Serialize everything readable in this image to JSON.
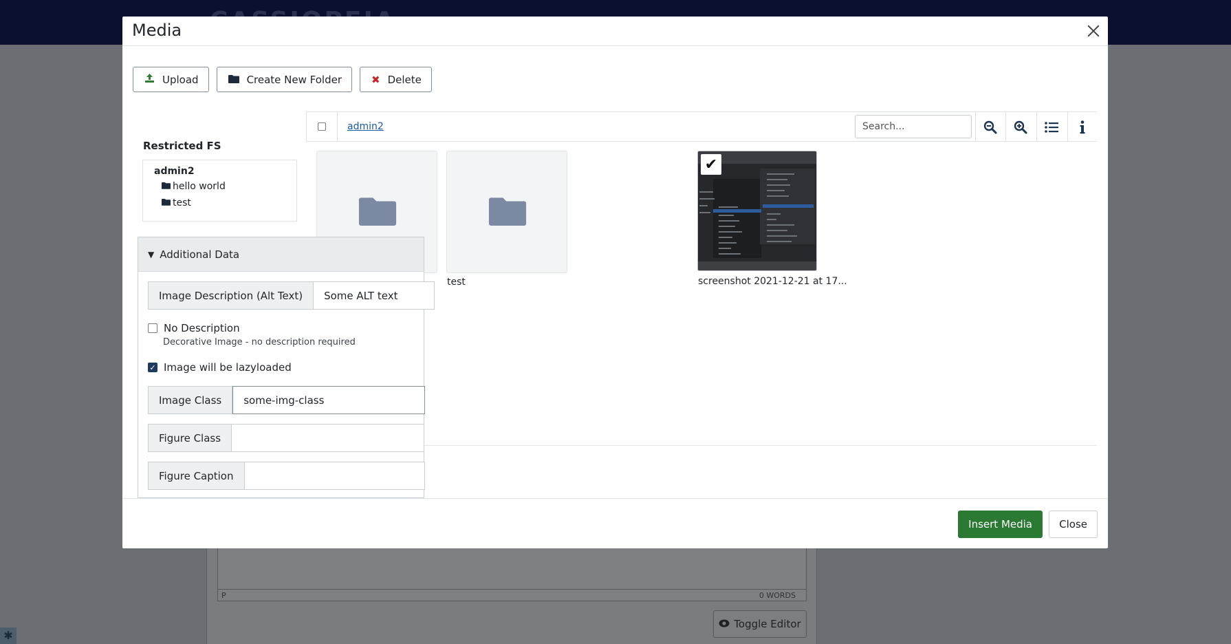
{
  "background": {
    "site_title": "CASSIOPEIA",
    "editor_status_left": "P",
    "editor_status_right": "0 WORDS",
    "toggle_editor_label": "Toggle Editor"
  },
  "modal": {
    "title": "Media",
    "toolbar": {
      "upload_label": "Upload",
      "create_folder_label": "Create New Folder",
      "delete_label": "Delete"
    },
    "tree": {
      "title": "Restricted FS",
      "root": "admin2",
      "items": [
        "hello world",
        "test"
      ]
    },
    "browser": {
      "breadcrumb": "admin2",
      "search_placeholder": "Search...",
      "icons": [
        "zoom-out-icon",
        "zoom-in-icon",
        "list-view-icon",
        "info-icon"
      ],
      "items": [
        {
          "name": "",
          "type": "folder"
        },
        {
          "name": "test",
          "type": "folder"
        },
        {
          "name": "screenshot 2021-12-21 at 17...",
          "type": "image",
          "selected": true
        }
      ]
    },
    "additional_data": {
      "header": "Additional Data",
      "alt_label": "Image Description (Alt Text)",
      "alt_value": "Some ALT text",
      "no_desc_label": "No Description",
      "no_desc_checked": false,
      "no_desc_note": "Decorative Image - no description required",
      "lazy_label": "Image will be lazyloaded",
      "lazy_checked": true,
      "image_class_label": "Image Class",
      "image_class_value": "some-img-class",
      "figure_class_label": "Figure Class",
      "figure_class_value": "",
      "figure_caption_label": "Figure Caption",
      "figure_caption_value": ""
    },
    "footer": {
      "insert_label": "Insert Media",
      "close_label": "Close"
    },
    "colors": {
      "insert_button": "#2b7a34",
      "delete_icon": "#c52827",
      "upload_icon": "#2f7d32",
      "link": "#1a5aa6"
    }
  }
}
